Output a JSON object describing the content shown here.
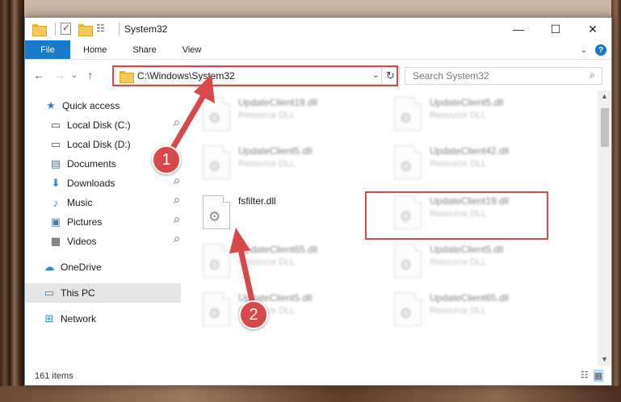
{
  "window": {
    "title": "System32",
    "caption": {
      "minimize": "—",
      "maximize": "☐",
      "close": "✕"
    }
  },
  "ribbon": {
    "tabs": [
      "File",
      "Home",
      "Share",
      "View"
    ],
    "expand_icon": "chevron-down-icon",
    "help_label": "?"
  },
  "nav": {
    "back": "←",
    "forward": "→",
    "history": "⌄",
    "up": "↑",
    "address": "C:\\Windows\\System32",
    "dropdown": "⌄",
    "refresh": "↻",
    "search_placeholder": "Search System32",
    "search_glyph": "⌕"
  },
  "sidebar": [
    {
      "label": "Quick access",
      "icon": "star-icon",
      "glyph": "★",
      "color": "#2b88d8",
      "pinned": false
    },
    {
      "label": "Local Disk (C:)",
      "icon": "drive-icon",
      "glyph": "▭",
      "color": "#555555",
      "pinned": true
    },
    {
      "label": "Local Disk (D:)",
      "icon": "drive-icon",
      "glyph": "▭",
      "color": "#555555",
      "pinned": false
    },
    {
      "label": "Documents",
      "icon": "documents-icon",
      "glyph": "▤",
      "color": "#5a6f86",
      "pinned": true
    },
    {
      "label": "Downloads",
      "icon": "download-icon",
      "glyph": "⬇",
      "color": "#2b88d8",
      "pinned": true
    },
    {
      "label": "Music",
      "icon": "music-icon",
      "glyph": "♪",
      "color": "#2b88d8",
      "pinned": true
    },
    {
      "label": "Pictures",
      "icon": "pictures-icon",
      "glyph": "▣",
      "color": "#4a7aa8",
      "pinned": true
    },
    {
      "label": "Videos",
      "icon": "videos-icon",
      "glyph": "▦",
      "color": "#444444",
      "pinned": true
    },
    {
      "label": "OneDrive",
      "icon": "cloud-icon",
      "glyph": "☁",
      "color": "#2b88d8",
      "pinned": false
    },
    {
      "label": "This PC",
      "icon": "computer-icon",
      "glyph": "▭",
      "color": "#2b88d8",
      "pinned": false,
      "selected": true
    },
    {
      "label": "Network",
      "icon": "network-icon",
      "glyph": "⊞",
      "color": "#2b88d8",
      "pinned": false
    }
  ],
  "pin_glyph": "📌",
  "files": [
    {
      "name": "UpdateClient19.dll",
      "type": "Resource DLL",
      "blurred": true
    },
    {
      "name": "UpdateClient5.dll",
      "type": "Resource DLL",
      "blurred": true
    },
    {
      "name": "UpdateClient5.dll",
      "type": "Resource DLL",
      "blurred": true
    },
    {
      "name": "UpdateClient42.dll",
      "type": "Resource DLL",
      "blurred": true
    },
    {
      "name": "fsfilter.dll",
      "type": "",
      "blurred": false
    },
    {
      "name": "UpdateClient19.dll",
      "type": "Resource DLL",
      "blurred": true
    },
    {
      "name": "UpdateClient65.dll",
      "type": "Resource DLL",
      "blurred": true
    },
    {
      "name": "UpdateClient5.dll",
      "type": "Resource DLL",
      "blurred": true
    },
    {
      "name": "UpdateClient5.dll",
      "type": "Resource DLL",
      "blurred": true
    },
    {
      "name": "UpdateClient65.dll",
      "type": "Resource DLL",
      "blurred": true
    }
  ],
  "gear_glyph": "⚙",
  "status": {
    "items": "161 items"
  },
  "callouts": [
    "1",
    "2"
  ],
  "accent_color": "#1979ca",
  "highlight_color": "#d94848"
}
